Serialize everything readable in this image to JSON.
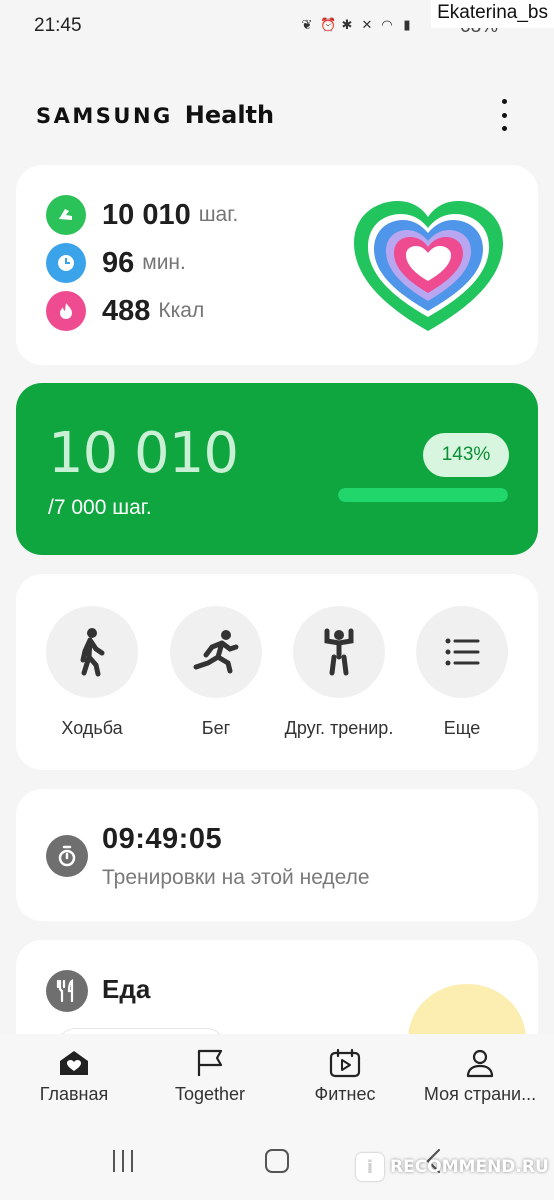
{
  "status_bar": {
    "time": "21:45",
    "battery": "68%",
    "icons": [
      "leaf-icon",
      "alarm-icon",
      "bluetooth-icon",
      "mute-icon",
      "wifi-icon",
      "signal-icon",
      "battery-icon"
    ]
  },
  "watermark": {
    "user": "Ekaterina_bs",
    "site": "RECOMMEND.RU"
  },
  "header": {
    "brand_primary": "SAMSUNG",
    "brand_secondary": "Health"
  },
  "summary": {
    "steps": {
      "value": "10 010",
      "unit": "шаг.",
      "color": "#2bc25a"
    },
    "active_time": {
      "value": "96",
      "unit": "мин.",
      "color": "#3ba3ea"
    },
    "calories": {
      "value": "488",
      "unit": "Ккал",
      "color": "#ef4b91"
    }
  },
  "steps_card": {
    "count": "10 010",
    "goal": "/7 000 шаг.",
    "percent": "143%",
    "progress": 1.0,
    "color": "#0fa640"
  },
  "workouts": [
    {
      "label": "Ходьба",
      "icon": "walking-icon"
    },
    {
      "label": "Бег",
      "icon": "running-icon"
    },
    {
      "label": "Друг. тренир.",
      "icon": "exercise-icon"
    },
    {
      "label": "Еще",
      "icon": "list-icon"
    }
  ],
  "timer_card": {
    "value": "09:49:05",
    "caption": "Тренировки на этой неделе"
  },
  "food_card": {
    "title": "Еда"
  },
  "bottom_nav": [
    {
      "label": "Главная",
      "icon": "home-heart-icon",
      "active": true
    },
    {
      "label": "Together",
      "icon": "flag-icon",
      "active": false
    },
    {
      "label": "Фитнес",
      "icon": "play-calendar-icon",
      "active": false
    },
    {
      "label": "Моя страни...",
      "icon": "person-icon",
      "active": false
    }
  ]
}
